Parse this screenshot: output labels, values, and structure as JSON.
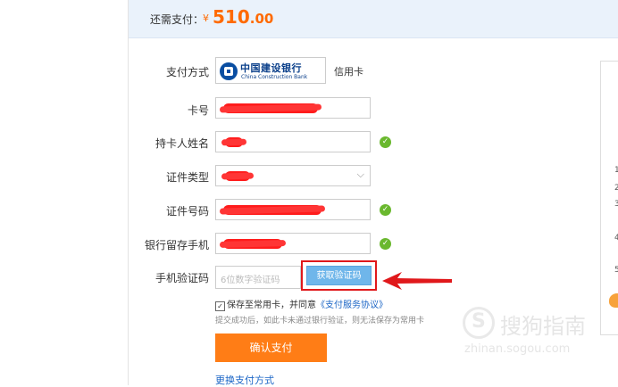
{
  "header": {
    "label": "还需支付：",
    "currency": "¥",
    "amount_int": "510",
    "amount_dec": ".00"
  },
  "form": {
    "payment_method": {
      "label": "支付方式",
      "bank_name_cn": "中国建设银行",
      "bank_name_en": "China Construction Bank",
      "card_type": "信用卡"
    },
    "card_number": {
      "label": "卡号",
      "value": ""
    },
    "holder_name": {
      "label": "持卡人姓名",
      "value": ""
    },
    "id_type": {
      "label": "证件类型",
      "value": ""
    },
    "id_number": {
      "label": "证件号码",
      "value": ""
    },
    "phone": {
      "label": "银行留存手机",
      "value": ""
    },
    "sms_code": {
      "label": "手机验证码",
      "placeholder": "6位数字验证码",
      "button": "获取验证码"
    },
    "agree": {
      "text": "保存至常用卡，并同意",
      "link": "《支付服务协议》"
    },
    "hint": "提交成功后，如此卡未通过银行验证，则无法保存为常用卡",
    "confirm": "确认支付",
    "switch": "更换支付方式"
  },
  "side_numbers": [
    "1",
    "2",
    "3",
    "4",
    "5"
  ],
  "watermark": {
    "text": "搜狗指南",
    "url": "zhinan.sogou.com"
  },
  "colors": {
    "accent": "#ff6a00",
    "button": "#ff7d16",
    "sms_button": "#6fb6ea",
    "highlight": "#e0181b",
    "ok": "#6ab82e",
    "link": "#1c66c6"
  },
  "icons": {
    "ok": "check-circle-icon",
    "dropdown": "chevron-down-icon",
    "annotation": "red-arrow-icon"
  }
}
